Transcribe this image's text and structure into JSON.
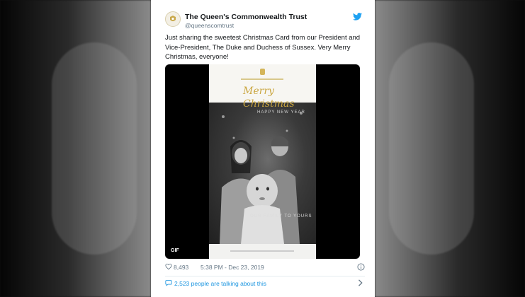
{
  "tweet": {
    "display_name": "The Queen's Commonwealth Trust",
    "handle": "@queenscomtrust",
    "text": "Just sharing the sweetest Christmas Card from our President and Vice-President, The Duke and Duchess of Sussex. Very Merry Christmas, everyone!",
    "likes": "8,493",
    "timestamp": "5:38 PM - Dec 23, 2019",
    "talking_about": "2,523 people are talking about this"
  },
  "media": {
    "badge": "GIF",
    "card_line1": "Merry",
    "card_line2": "Christmas",
    "card_newyear": "HAPPY NEW YEAR",
    "card_family": "OUR FAMILY TO YOURS"
  },
  "colors": {
    "twitter_blue": "#1da1f2",
    "link_blue": "#1b95e0",
    "gold": "#caa640"
  },
  "icons": [
    "twitter-bird-icon",
    "heart-icon",
    "info-icon",
    "speech-bubble-icon",
    "chevron-right-icon"
  ]
}
